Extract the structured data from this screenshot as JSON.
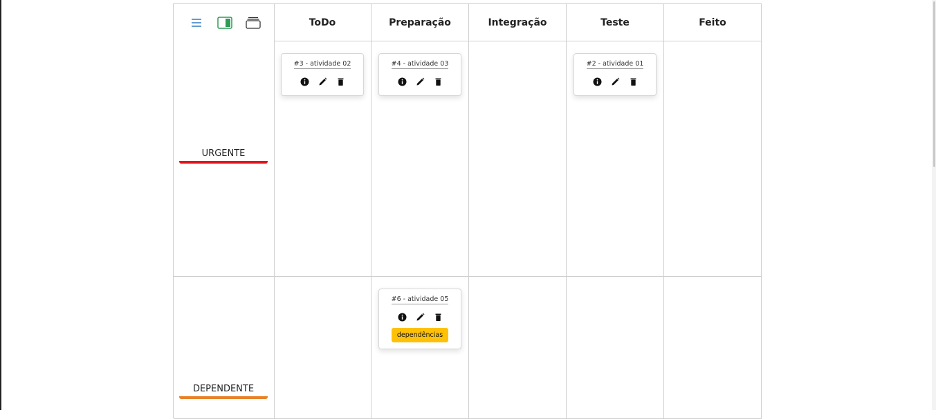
{
  "columns": [
    "ToDo",
    "Preparação",
    "Integração",
    "Teste",
    "Feito"
  ],
  "view_icons": [
    "list-view-icon",
    "split-panel-icon",
    "stacked-layers-icon"
  ],
  "rows": [
    {
      "label": "URGENTE",
      "color": "#e3141b"
    },
    {
      "label": "DEPENDENTE",
      "color": "#e8822a"
    }
  ],
  "cards": {
    "urgente_todo": {
      "title": "#3 - atividade 02"
    },
    "urgente_preparacao": {
      "title": "#4 - atividade 03"
    },
    "urgente_teste": {
      "title": "#2 - atividade 01"
    },
    "dependente_preparacao": {
      "title": "#6 - atividade 05",
      "dependency_label": "dependências"
    }
  },
  "card_actions": [
    "info-icon",
    "edit-icon",
    "delete-icon"
  ],
  "colors": {
    "accent_blue": "#3b82c4",
    "accent_green": "#2e9b57",
    "dependency_yellow": "#ffc107"
  }
}
